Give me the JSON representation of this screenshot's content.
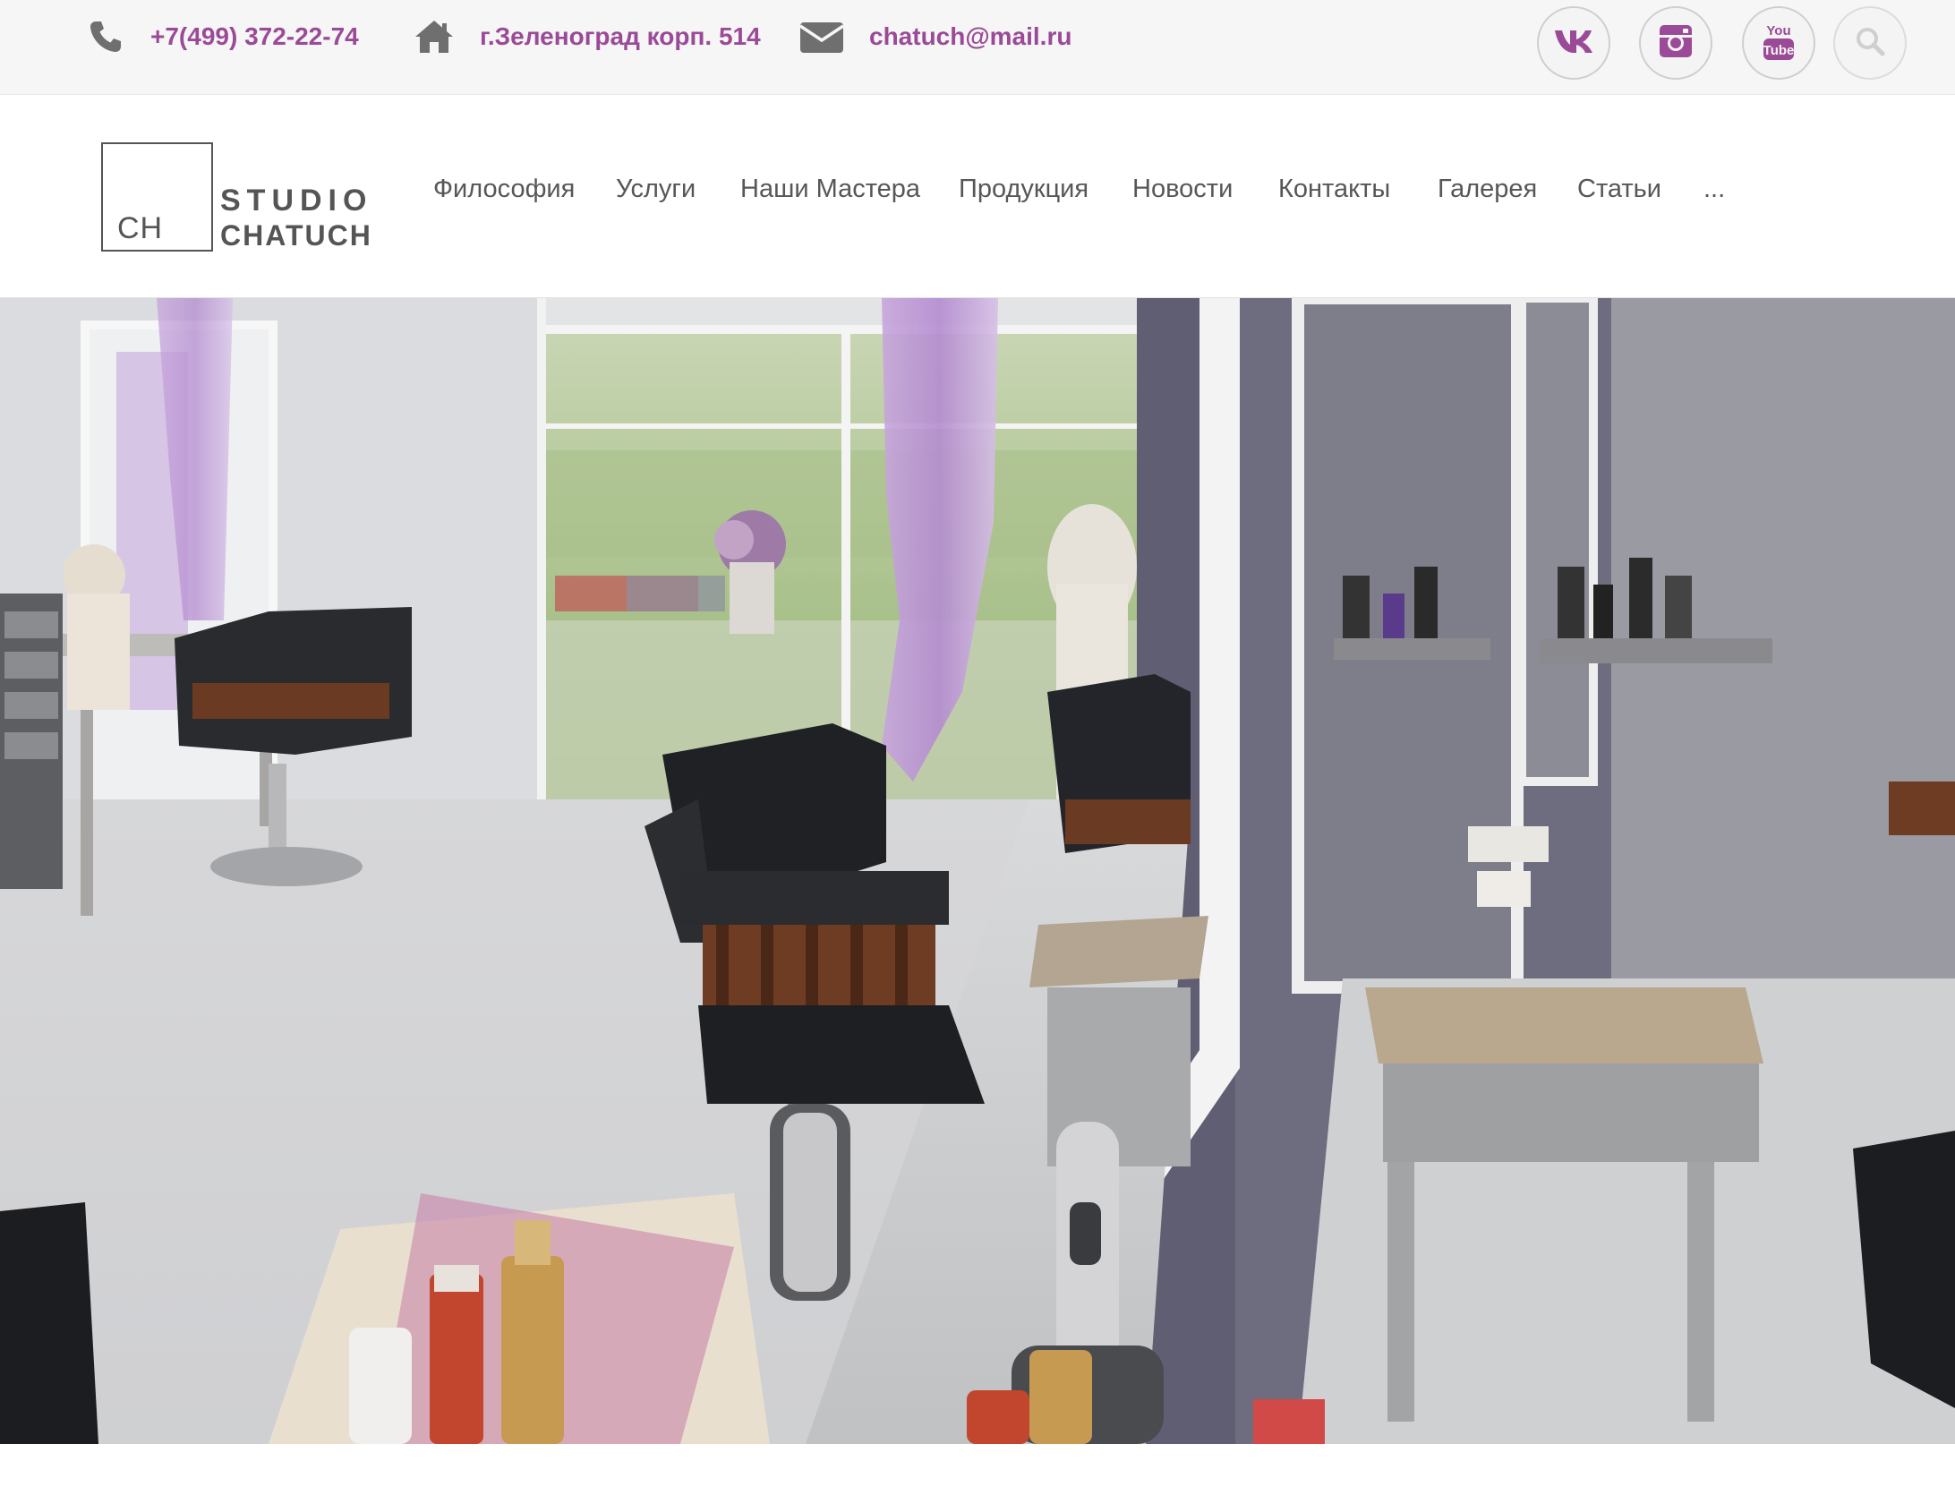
{
  "topbar": {
    "phone": "+7(499) 372-22-74",
    "address": "г.Зеленоград корп. 514",
    "email": "chatuch@mail.ru",
    "accent_color": "#9b4a97",
    "icons": [
      "phone-icon",
      "home-icon",
      "envelope-icon"
    ],
    "social": [
      {
        "name": "vk",
        "icon": "vk-icon"
      },
      {
        "name": "instagram",
        "icon": "instagram-icon"
      },
      {
        "name": "youtube",
        "icon": "youtube-icon",
        "glyph_top": "You",
        "glyph_bottom": "Tube"
      },
      {
        "name": "search",
        "icon": "search-icon"
      }
    ]
  },
  "logo": {
    "mark": "CH",
    "line1": "STUDIO",
    "line2": "CHATUCH"
  },
  "nav": {
    "items": [
      {
        "label": "Философия"
      },
      {
        "label": "Услуги"
      },
      {
        "label": "Наши Мастера"
      },
      {
        "label": "Продукция"
      },
      {
        "label": "Новости"
      },
      {
        "label": "Контакты"
      },
      {
        "label": "Галерея"
      },
      {
        "label": "Статьи"
      },
      {
        "label": "..."
      }
    ]
  },
  "hero": {
    "image": "salon-interior-photo"
  }
}
